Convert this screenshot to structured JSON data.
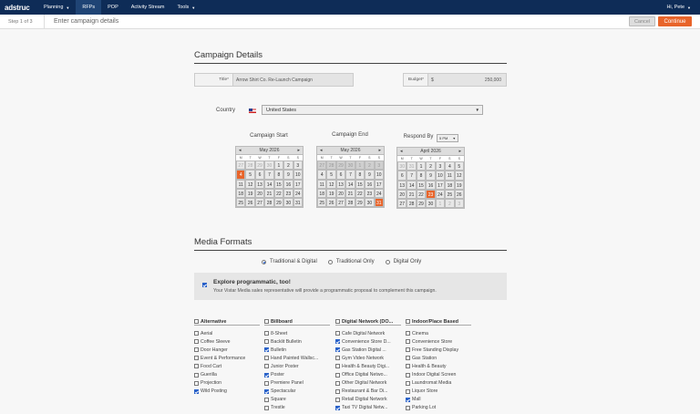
{
  "nav": {
    "logo": "adstruc",
    "items": [
      {
        "label": "Planning",
        "caret": "▼"
      },
      {
        "label": "RFPs"
      },
      {
        "label": "POP"
      },
      {
        "label": "Activity Stream"
      },
      {
        "label": "Tools",
        "caret": "▼"
      }
    ],
    "user": "Hi, Pete",
    "user_caret": "▼"
  },
  "subheader": {
    "step": "Step 1 of 3",
    "title": "Enter campaign details",
    "cancel": "Cancel",
    "continue": "Continue"
  },
  "campaign": {
    "heading": "Campaign Details",
    "title_label": "Title*",
    "title_value": "Arrow Shirt Co. Re-Launch Campaign",
    "budget_label": "Budget*",
    "budget_currency": "$",
    "budget_value": "250,000",
    "country_label": "Country",
    "country_value": "United States",
    "select_caret": "▼"
  },
  "calendars": {
    "start_title": "Campaign Start",
    "end_title": "Campaign End",
    "respond_title": "Respond By",
    "respond_time": "5 PM",
    "prev": "◂",
    "next": "▸",
    "weekdays": [
      "M",
      "T",
      "W",
      "T",
      "F",
      "S",
      "S"
    ],
    "start_month": "May 2026",
    "end_month": "May 2026",
    "respond_month": "April 2026",
    "start_days": [
      "27",
      "28",
      "29",
      "30",
      "1",
      "2",
      "3",
      "4",
      "5",
      "6",
      "7",
      "8",
      "9",
      "10",
      "11",
      "12",
      "13",
      "14",
      "15",
      "16",
      "17",
      "18",
      "19",
      "20",
      "21",
      "22",
      "23",
      "24",
      "25",
      "26",
      "27",
      "28",
      "29",
      "30",
      "31"
    ],
    "end_days": [
      "27",
      "28",
      "29",
      "30",
      "1",
      "2",
      "3",
      "4",
      "5",
      "6",
      "7",
      "8",
      "9",
      "10",
      "11",
      "12",
      "13",
      "14",
      "15",
      "16",
      "17",
      "18",
      "19",
      "20",
      "21",
      "22",
      "23",
      "24",
      "25",
      "26",
      "27",
      "28",
      "29",
      "30",
      "31"
    ],
    "respond_days": [
      "30",
      "31",
      "1",
      "2",
      "3",
      "4",
      "5",
      "6",
      "7",
      "8",
      "9",
      "10",
      "11",
      "12",
      "13",
      "14",
      "15",
      "16",
      "17",
      "18",
      "19",
      "20",
      "21",
      "22",
      "23",
      "24",
      "25",
      "26",
      "27",
      "28",
      "29",
      "30",
      "1",
      "2",
      "3"
    ]
  },
  "media": {
    "heading": "Media Formats",
    "radios": [
      {
        "label": "Traditional & Digital",
        "selected": true
      },
      {
        "label": "Traditional Only",
        "selected": false
      },
      {
        "label": "Digital Only",
        "selected": false
      }
    ],
    "promo_title": "Explore programmatic, too!",
    "promo_desc": "Your Vistar Media sales representative will provide a programmatic proposal to complement this campaign.",
    "columns": [
      {
        "header": "Alternative",
        "items": [
          {
            "label": "Aerial",
            "checked": false
          },
          {
            "label": "Coffee Sleeve",
            "checked": false
          },
          {
            "label": "Door Hanger",
            "checked": false
          },
          {
            "label": "Event & Performance",
            "checked": false
          },
          {
            "label": "Food Cart",
            "checked": false
          },
          {
            "label": "Guerilla",
            "checked": false
          },
          {
            "label": "Projection",
            "checked": false
          },
          {
            "label": "Wild Posting",
            "checked": true
          }
        ]
      },
      {
        "header": "Billboard",
        "items": [
          {
            "label": "8-Sheet",
            "checked": false
          },
          {
            "label": "Backlit Bulletin",
            "checked": false
          },
          {
            "label": "Bulletin",
            "checked": true
          },
          {
            "label": "Hand Painted Wallsc...",
            "checked": false
          },
          {
            "label": "Junior Poster",
            "checked": false
          },
          {
            "label": "Poster",
            "checked": true
          },
          {
            "label": "Premiere Panel",
            "checked": false
          },
          {
            "label": "Spectacular",
            "checked": true
          },
          {
            "label": "Square",
            "checked": false
          },
          {
            "label": "Trestle",
            "checked": false
          }
        ]
      },
      {
        "header": "Digital Network (DO...",
        "items": [
          {
            "label": "Cafe Digital Network",
            "checked": false
          },
          {
            "label": "Convenience Store D...",
            "checked": true
          },
          {
            "label": "Gas Station Digital ...",
            "checked": true
          },
          {
            "label": "Gym Video Network",
            "checked": false
          },
          {
            "label": "Health & Beauty Digi...",
            "checked": false
          },
          {
            "label": "Office Digital Netwo...",
            "checked": false
          },
          {
            "label": "Other Digital Network",
            "checked": false
          },
          {
            "label": "Restaurant & Bar Di...",
            "checked": false
          },
          {
            "label": "Retail Digital Network",
            "checked": false
          },
          {
            "label": "Taxi TV Digital Netw...",
            "checked": true
          }
        ]
      },
      {
        "header": "Indoor/Place Based",
        "items": [
          {
            "label": "Cinema",
            "checked": false
          },
          {
            "label": "Convenience Store",
            "checked": false
          },
          {
            "label": "Free Standing Display",
            "checked": false
          },
          {
            "label": "Gas Station",
            "checked": false
          },
          {
            "label": "Health & Beauty",
            "checked": false
          },
          {
            "label": "Indoor Digital Screen",
            "checked": false
          },
          {
            "label": "Laundromat Media",
            "checked": false
          },
          {
            "label": "Liquor Store",
            "checked": false
          },
          {
            "label": "Mall",
            "checked": true
          },
          {
            "label": "Parking Lot",
            "checked": false
          }
        ]
      }
    ]
  }
}
